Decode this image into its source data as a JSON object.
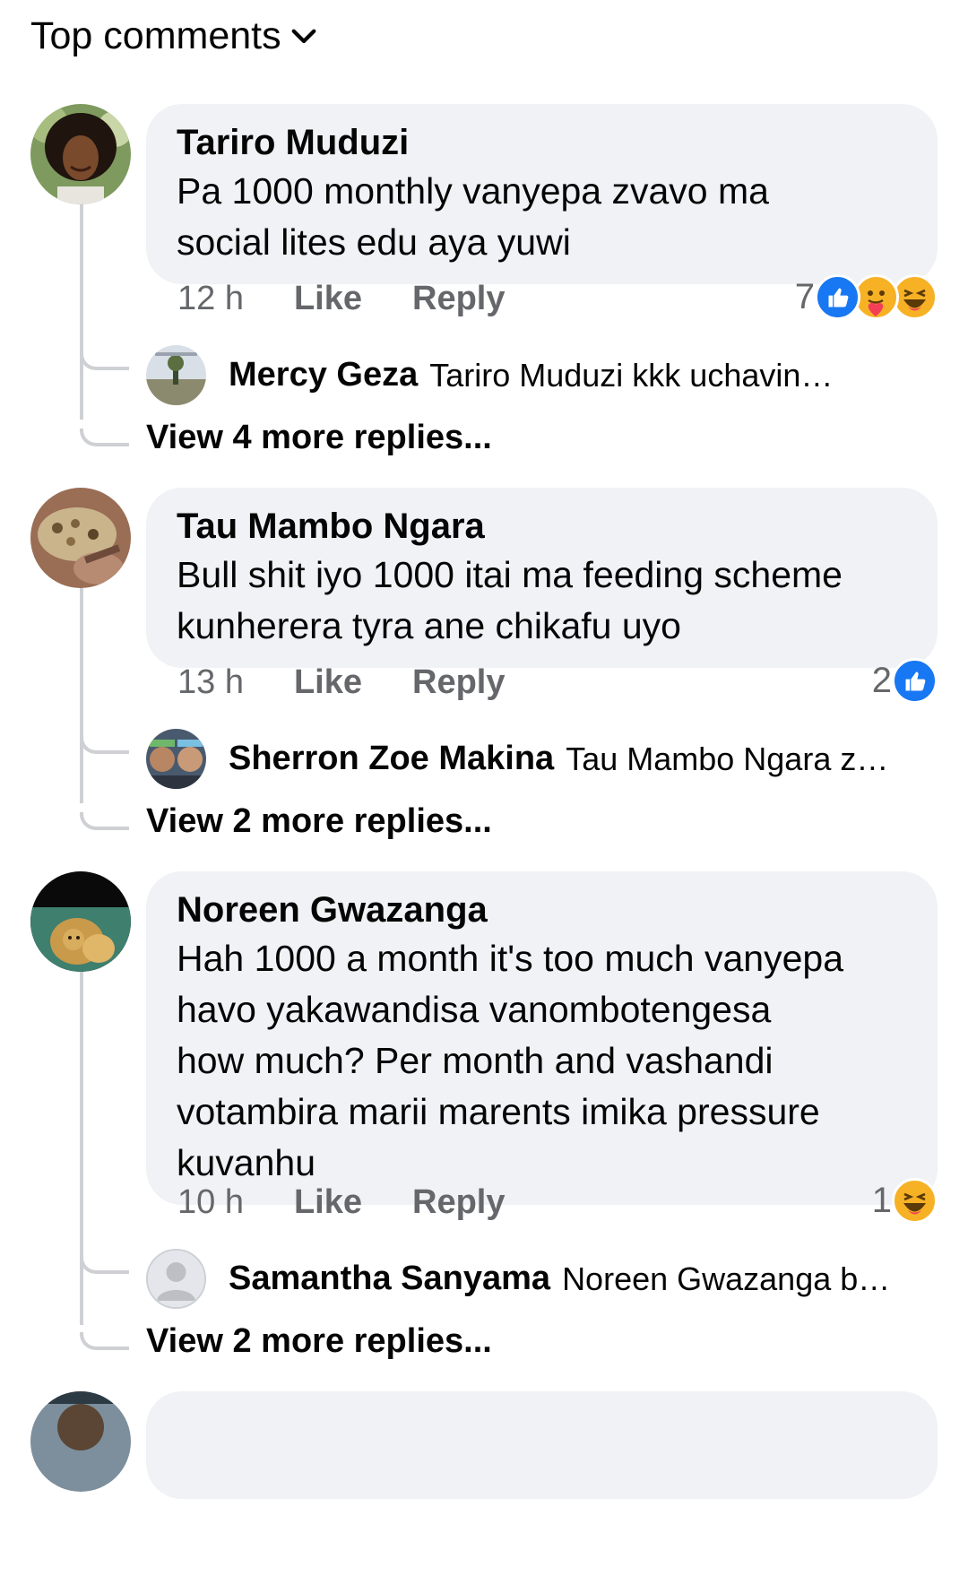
{
  "header": {
    "label": "Top comments"
  },
  "comments": [
    {
      "author": "Tariro Muduzi",
      "lines": [
        "Pa 1000 monthly vanyepa zvavo ma",
        "social lites edu aya yuwi"
      ],
      "time": "12 h",
      "like_label": "Like",
      "reply_label": "Reply",
      "reaction_count": "7",
      "reactions": [
        "like",
        "care",
        "haha"
      ],
      "reply": {
        "author": "Mercy Geza",
        "text": "Tariro Muduzi kkk uchavingwa"
      },
      "view_more": "View 4 more replies..."
    },
    {
      "author": "Tau Mambo Ngara",
      "lines": [
        "Bull shit iyo 1000 itai ma feeding scheme",
        "kunherera tyra ane chikafu uyo"
      ],
      "time": "13 h",
      "like_label": "Like",
      "reply_label": "Reply",
      "reaction_count": "2",
      "reactions": [
        "like"
      ],
      "reply": {
        "author": "Sherron Zoe Makina",
        "text": "Tau Mambo Ngara zvak..."
      },
      "view_more": "View 2 more replies..."
    },
    {
      "author": "Noreen Gwazanga",
      "lines": [
        "Hah 1000 a month it's too much vanyepa",
        "havo yakawandisa vanombotengesa",
        "how much? Per month and vashandi",
        "votambira marii marents imika pressure",
        "kuvanhu"
      ],
      "time": "10 h",
      "like_label": "Like",
      "reply_label": "Reply",
      "reaction_count": "1",
      "reactions": [
        "haha"
      ],
      "reply": {
        "author": "Samantha Sanyama",
        "text": "Noreen Gwazanga bvun..."
      },
      "view_more": "View 2 more replies..."
    }
  ],
  "colors": {
    "like_blue": "#1877f2",
    "bubble": "#f0f2f5",
    "meta_gray": "#65676b",
    "thread_line": "#ced0d4"
  }
}
